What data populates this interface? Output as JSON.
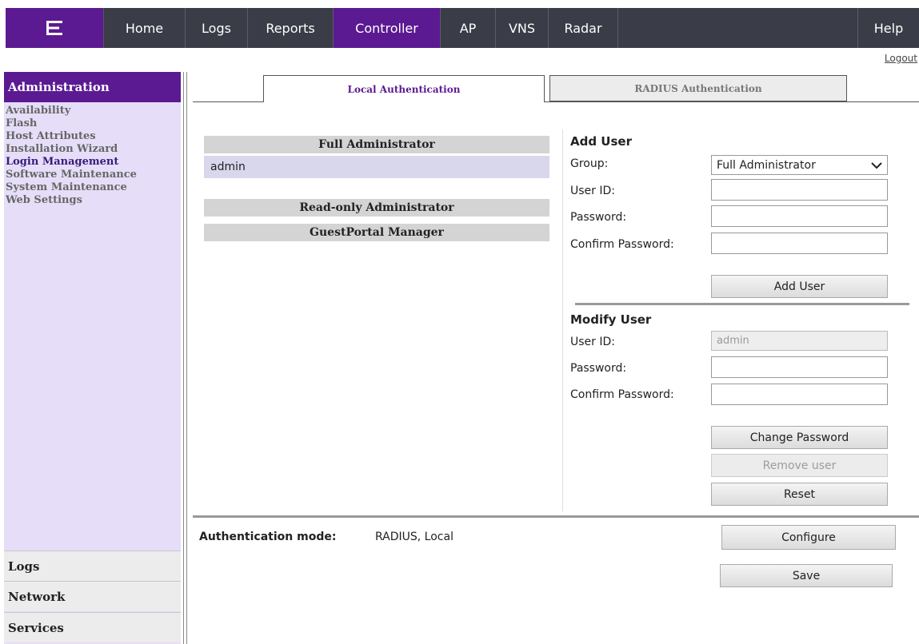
{
  "nav": {
    "logo_icon": "extreme-logo-icon",
    "items": [
      "Home",
      "Logs",
      "Reports",
      "Controller",
      "AP",
      "VNS",
      "Radar"
    ],
    "active": "Controller",
    "help": "Help",
    "logout": "Logout",
    "accent_color": "#5b1a92",
    "bar_color": "#3a3d47"
  },
  "sidebar": {
    "header": "Administration",
    "links": [
      "Availability",
      "Flash",
      "Host Attributes",
      "Installation Wizard",
      "Login Management",
      "Software Maintenance",
      "System Maintenance",
      "Web Settings"
    ],
    "current": "Login Management",
    "sections": [
      "Logs",
      "Network",
      "Services"
    ]
  },
  "tabs": {
    "local": "Local Authentication",
    "radius": "RADIUS Authentication",
    "active": "Local Authentication"
  },
  "groups": {
    "full_admin": "Full Administrator",
    "full_admin_members": [
      "admin"
    ],
    "readonly_admin": "Read-only Administrator",
    "guestportal": "GuestPortal Manager"
  },
  "add_user": {
    "title": "Add User",
    "group_label": "Group:",
    "group_value": "Full Administrator",
    "userid_label": "User ID:",
    "password_label": "Password:",
    "confirm_label": "Confirm Password:",
    "button": "Add User"
  },
  "modify_user": {
    "title": "Modify User",
    "userid_label": "User ID:",
    "userid_value": "admin",
    "password_label": "Password:",
    "confirm_label": "Confirm Password:",
    "change_button": "Change Password",
    "remove_button": "Remove user",
    "reset_button": "Reset"
  },
  "auth": {
    "mode_label": "Authentication mode:",
    "mode_value": "RADIUS, Local",
    "configure_button": "Configure",
    "save_button": "Save"
  }
}
